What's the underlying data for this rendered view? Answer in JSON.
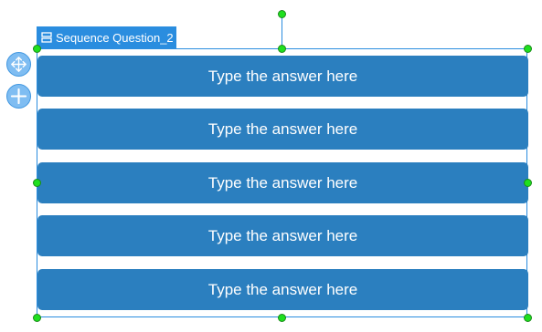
{
  "component": {
    "title": "Sequence Question_2",
    "type_icon": "list-layout-icon"
  },
  "toolbar": {
    "move_icon": "move-arrows-icon",
    "add_icon": "plus-icon"
  },
  "answers": [
    {
      "placeholder": "Type the answer here"
    },
    {
      "placeholder": "Type the answer here"
    },
    {
      "placeholder": "Type the answer here"
    },
    {
      "placeholder": "Type the answer here"
    },
    {
      "placeholder": "Type the answer here"
    }
  ],
  "colors": {
    "selection": "#2a8ddf",
    "answer_bg": "#2b7fbf",
    "handle": "#1fe01f",
    "side_button": "#7fbdf2"
  }
}
